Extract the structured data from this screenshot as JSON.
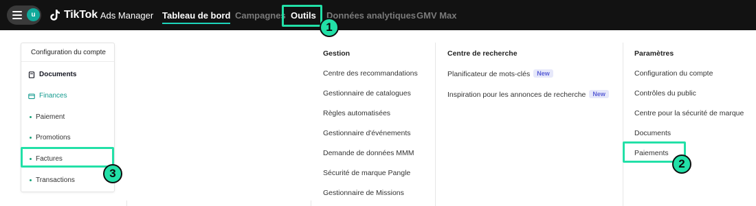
{
  "header": {
    "avatar_initial": "u",
    "brand": "TikTok",
    "brand_sub": "Ads Manager",
    "nav": [
      {
        "label": "Tableau de bord"
      },
      {
        "label": "Campagnes"
      },
      {
        "label": "Outils"
      },
      {
        "label": "Données analytiques"
      },
      {
        "label": "GMV Max"
      }
    ]
  },
  "left_panel": {
    "heading": "Configuration du compte",
    "documents": "Documents",
    "finances": "Finances",
    "sub_items": [
      "Paiement",
      "Promotions",
      "Factures",
      "Transactions"
    ]
  },
  "columns": {
    "gestion": {
      "heading": "Gestion",
      "items": [
        "Centre des recommandations",
        "Gestionnaire de catalogues",
        "Règles automatisées",
        "Gestionnaire d'événements",
        "Demande de données MMM",
        "Sécurité de marque Pangle",
        "Gestionnaire de Missions"
      ]
    },
    "recherche": {
      "heading": "Centre de recherche",
      "items": [
        {
          "label": "Planificateur de mots-clés",
          "tag": "New"
        },
        {
          "label": "Inspiration pour les annonces de recherche",
          "tag": "New"
        }
      ]
    },
    "parametres": {
      "heading": "Paramètres",
      "items": [
        "Configuration du compte",
        "Contrôles du public",
        "Centre pour la sécurité de marque",
        "Documents",
        "Paiements"
      ]
    }
  },
  "annotations": [
    "1",
    "2",
    "3"
  ],
  "colors": {
    "topbar": "#121212",
    "highlight": "#22e0a7",
    "teal": "#129a8e",
    "new_tag": "#5a5fd6"
  },
  "icons": [
    "menu-icon",
    "tiktok-logo-icon",
    "document-icon",
    "wallet-icon"
  ]
}
